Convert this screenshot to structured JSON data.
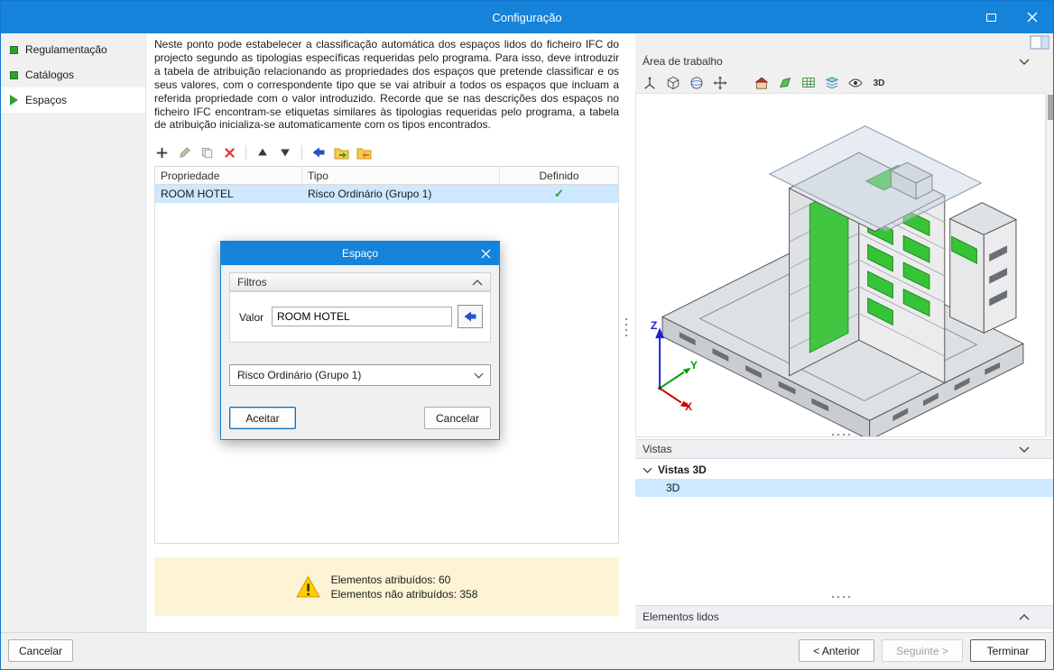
{
  "window": {
    "title": "Configuração"
  },
  "sidebar": {
    "items": [
      {
        "label": "Regulamentação"
      },
      {
        "label": "Catálogos"
      },
      {
        "label": "Espaços"
      }
    ]
  },
  "main": {
    "description": "Neste ponto pode estabelecer a classificação automática dos espaços lidos do ficheiro IFC do projecto segundo as tipologias específicas requeridas pelo programa. Para isso, deve introduzir a tabela de atribuição relacionando as propriedades dos espaços que pretende classificar e os seus valores, com o correspondente tipo que se vai atribuir a todos os espaços que incluam a referida propriedade com o valor introduzido. Recorde que se nas descrições dos espaços no ficheiro IFC encontram-se etiquetas similares às tipologias requeridas pelo programa, a tabela de atribuição inicializa-se automaticamente com os tipos encontrados.",
    "table": {
      "headers": {
        "propriedade": "Propriedade",
        "tipo": "Tipo",
        "definido": "Definido"
      },
      "row": {
        "propriedade": "ROOM HOTEL",
        "tipo": "Risco Ordinário (Grupo 1)",
        "definido": "✓"
      }
    },
    "warning": {
      "line1": "Elementos atribuídos: 60",
      "line2": "Elementos não atribuídos: 358"
    }
  },
  "modal": {
    "title": "Espaço",
    "filters": "Filtros",
    "valor_label": "Valor",
    "valor_value": "ROOM HOTEL",
    "tipo_value": "Risco Ordinário (Grupo 1)",
    "accept": "Aceitar",
    "cancel": "Cancelar"
  },
  "right": {
    "workspace": "Área de trabalho",
    "views": "Vistas",
    "views3d": "Vistas 3D",
    "view3d_item": "3D",
    "elements": "Elementos lidos",
    "tool_3d": "3D",
    "axes": {
      "x": "X",
      "y": "Y",
      "z": "Z"
    }
  },
  "footer": {
    "cancel": "Cancelar",
    "previous": "< Anterior",
    "next": "Seguinte >",
    "finish": "Terminar"
  },
  "colors": {
    "accent_blue": "#1583d9",
    "selection_blue": "#cde8ff",
    "highlight_green": "#35c435",
    "warning_bg": "#fdf4d5"
  }
}
